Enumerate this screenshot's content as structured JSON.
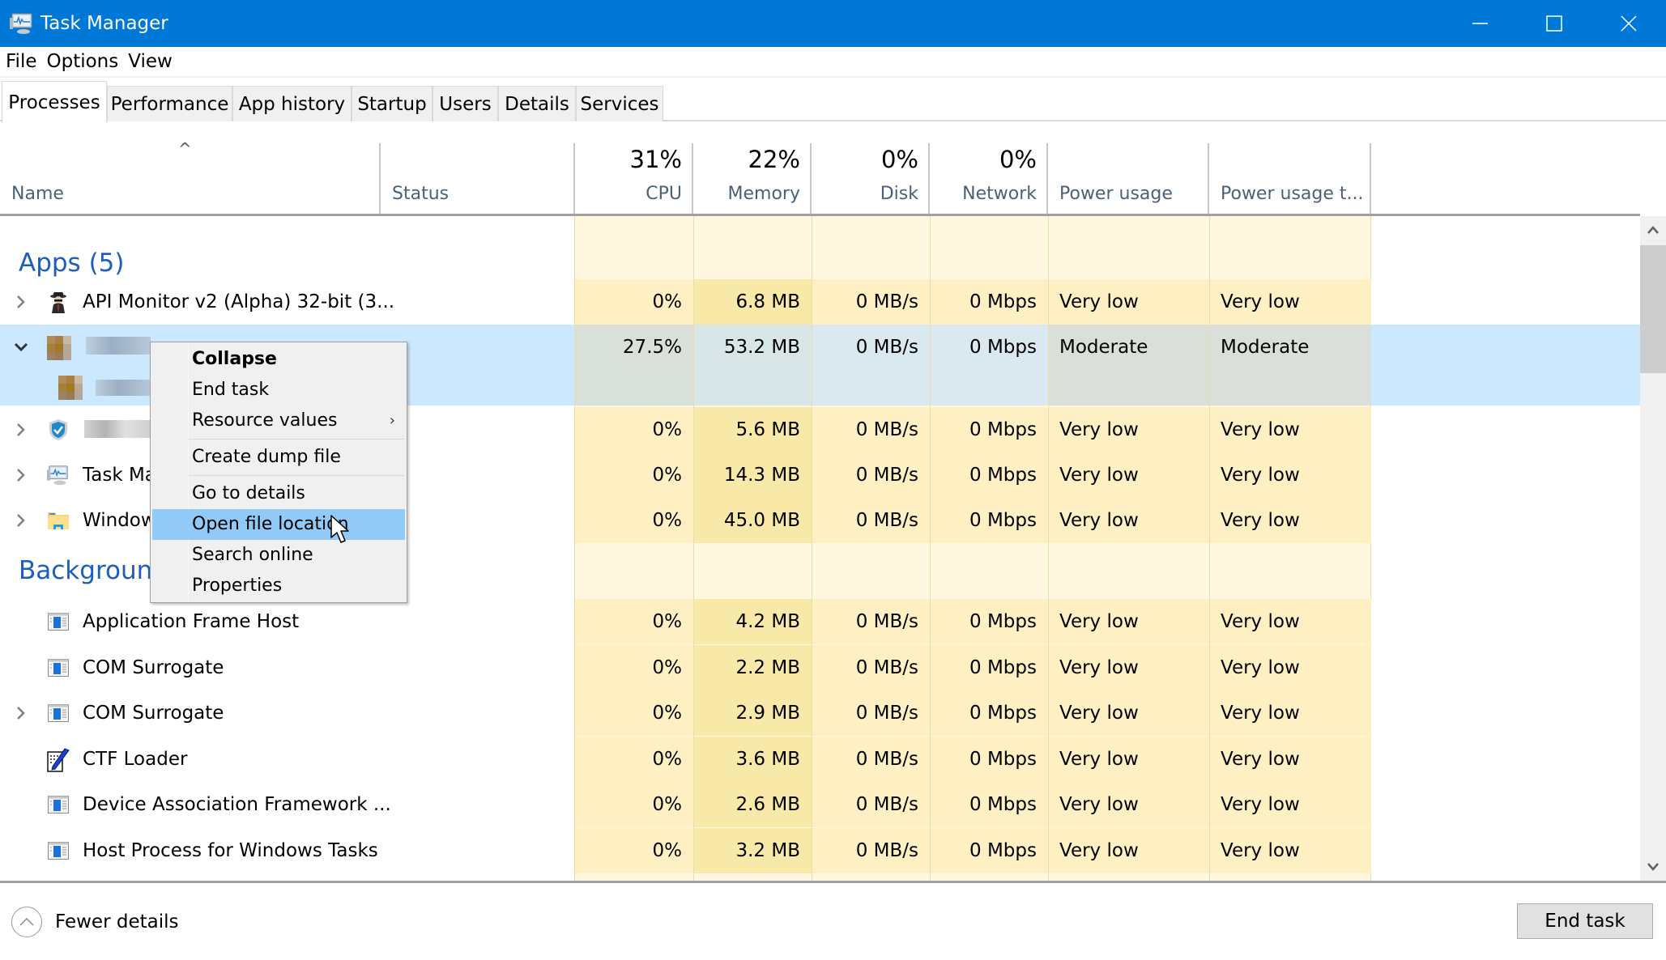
{
  "window": {
    "title": "Task Manager",
    "icon": "task-manager-icon",
    "controls": [
      "minimize-icon",
      "maximize-icon",
      "close-icon"
    ]
  },
  "menu": [
    "File",
    "Options",
    "View"
  ],
  "tabs": [
    {
      "label": "Processes",
      "active": true
    },
    {
      "label": "Performance"
    },
    {
      "label": "App history"
    },
    {
      "label": "Startup"
    },
    {
      "label": "Users"
    },
    {
      "label": "Details"
    },
    {
      "label": "Services"
    }
  ],
  "columns": {
    "name": {
      "label": "Name",
      "sort": "ascending"
    },
    "status": {
      "label": "Status"
    },
    "cpu": {
      "label": "CPU",
      "total": "31%"
    },
    "memory": {
      "label": "Memory",
      "total": "22%"
    },
    "disk": {
      "label": "Disk",
      "total": "0%"
    },
    "network": {
      "label": "Network",
      "total": "0%"
    },
    "power": {
      "label": "Power usage"
    },
    "power_trend": {
      "label": "Power usage t..."
    }
  },
  "groups": {
    "apps": {
      "title": "Apps (5)",
      "rows": [
        {
          "name": "API Monitor v2 (Alpha) 32-bit (3...",
          "icon": "spy-icon",
          "expander": "collapsed",
          "cpu": "0%",
          "memory": "6.8 MB",
          "disk": "0 MB/s",
          "network": "0 Mbps",
          "power": "Very low",
          "power_trend": "Very low"
        },
        {
          "name": "",
          "icon": "app-icon-blurred",
          "expander": "expanded",
          "selected": true,
          "cpu": "27.5%",
          "memory": "53.2 MB",
          "disk": "0 MB/s",
          "network": "0 Mbps",
          "power": "Moderate",
          "power_trend": "Moderate"
        },
        {
          "name": "",
          "icon": "shield-icon",
          "expander": "collapsed",
          "cpu": "0%",
          "memory": "5.6 MB",
          "disk": "0 MB/s",
          "network": "0 Mbps",
          "power": "Very low",
          "power_trend": "Very low"
        },
        {
          "name": "Task Ma",
          "icon": "task-manager-icon",
          "expander": "collapsed",
          "cpu": "0%",
          "memory": "14.3 MB",
          "disk": "0 MB/s",
          "network": "0 Mbps",
          "power": "Very low",
          "power_trend": "Very low"
        },
        {
          "name": "Window",
          "icon": "folder-icon",
          "expander": "collapsed",
          "cpu": "0%",
          "memory": "45.0 MB",
          "disk": "0 MB/s",
          "network": "0 Mbps",
          "power": "Very low",
          "power_trend": "Very low"
        }
      ]
    },
    "background": {
      "title": "Backgrounc",
      "rows": [
        {
          "name": "Application Frame Host",
          "icon": "window-app-icon",
          "expander": "none",
          "cpu": "0%",
          "memory": "4.2 MB",
          "disk": "0 MB/s",
          "network": "0 Mbps",
          "power": "Very low",
          "power_trend": "Very low"
        },
        {
          "name": "COM Surrogate",
          "icon": "window-app-icon",
          "expander": "none",
          "cpu": "0%",
          "memory": "2.2 MB",
          "disk": "0 MB/s",
          "network": "0 Mbps",
          "power": "Very low",
          "power_trend": "Very low"
        },
        {
          "name": "COM Surrogate",
          "icon": "window-app-icon",
          "expander": "collapsed",
          "cpu": "0%",
          "memory": "2.9 MB",
          "disk": "0 MB/s",
          "network": "0 Mbps",
          "power": "Very low",
          "power_trend": "Very low"
        },
        {
          "name": "CTF Loader",
          "icon": "notepad-pen-icon",
          "expander": "none",
          "cpu": "0%",
          "memory": "3.6 MB",
          "disk": "0 MB/s",
          "network": "0 Mbps",
          "power": "Very low",
          "power_trend": "Very low"
        },
        {
          "name": "Device Association Framework ...",
          "icon": "window-app-icon",
          "expander": "none",
          "cpu": "0%",
          "memory": "2.6 MB",
          "disk": "0 MB/s",
          "network": "0 Mbps",
          "power": "Very low",
          "power_trend": "Very low"
        },
        {
          "name": "Host Process for Windows Tasks",
          "icon": "window-app-icon",
          "expander": "none",
          "cpu": "0%",
          "memory": "3.2 MB",
          "disk": "0 MB/s",
          "network": "0 Mbps",
          "power": "Very low",
          "power_trend": "Very low"
        }
      ]
    }
  },
  "context_menu": {
    "items": [
      {
        "label": "Collapse",
        "bold": true
      },
      {
        "label": "End task"
      },
      {
        "label": "Resource values",
        "submenu": true
      },
      {
        "separator": true
      },
      {
        "label": "Create dump file"
      },
      {
        "separator": true
      },
      {
        "label": "Go to details"
      },
      {
        "label": "Open file location",
        "highlighted": true
      },
      {
        "label": "Search online"
      },
      {
        "label": "Properties"
      }
    ]
  },
  "footer": {
    "fewer_details": "Fewer details",
    "end_task": "End task"
  },
  "colors": {
    "titlebar": "#0078d7",
    "group_title": "#1d5dbf",
    "selection": "#cce8ff",
    "menu_highlight": "#91c9f7",
    "heat_light": "#fff7e0",
    "heat_medium": "#fff0c4",
    "heat_memory": "#f9e9a8"
  }
}
